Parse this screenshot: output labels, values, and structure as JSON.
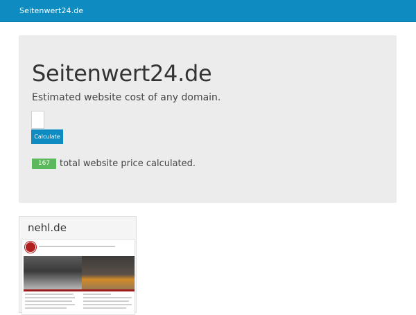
{
  "navbar": {
    "brand": "Seitenwert24.de"
  },
  "jumbotron": {
    "title": "Seitenwert24.de",
    "subtitle": "Estimated website cost of any domain.",
    "input_value": "",
    "button_label": "Calculate",
    "count": "167",
    "count_text": "total website price calculated."
  },
  "cards": [
    {
      "title": "nehl.de"
    }
  ],
  "colors": {
    "navbar": "#0e8cc2",
    "jumbotron_bg": "#ececec",
    "button": "#0e8cc2",
    "badge": "#5cb85c"
  }
}
